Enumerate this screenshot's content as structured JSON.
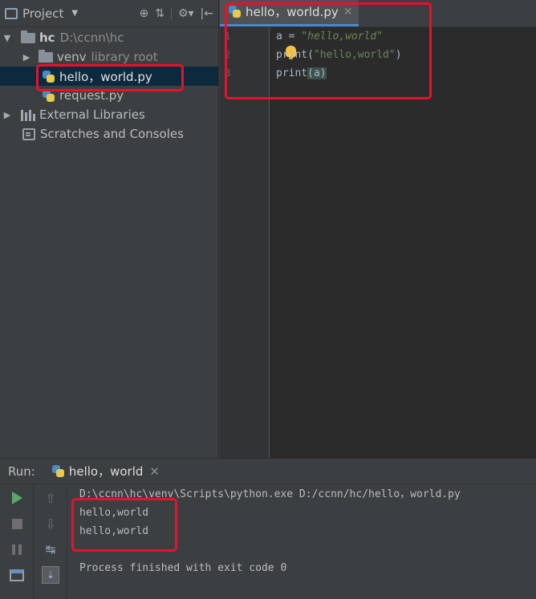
{
  "project": {
    "title": "Project",
    "tree": [
      {
        "name": "hc",
        "path": "D:\\ccnn\\hc",
        "type": "folder",
        "expanded": true
      },
      {
        "name": "venv",
        "note": "library root",
        "type": "folder",
        "expanded": false
      },
      {
        "name": "hello，world.py",
        "type": "python",
        "selected": true
      },
      {
        "name": "request.py",
        "type": "python"
      },
      {
        "name": "External Libraries",
        "type": "library"
      },
      {
        "name": "Scratches and Consoles",
        "type": "scratch"
      }
    ]
  },
  "editor": {
    "tab_label": "hello，world.py",
    "line_numbers": [
      "1",
      "2",
      "3"
    ],
    "code": {
      "l1_var": "a = ",
      "l1_str": "\"hello,world\"",
      "l2_fn": "print(",
      "l2_str": "\"hello,world\"",
      "l2_end": ")",
      "l3_fn": "print",
      "l3_arg": "(a)"
    }
  },
  "run": {
    "label": "Run:",
    "tab_label": "hello，world",
    "console": [
      "D:\\ccnn\\hc\\venv\\Scripts\\python.exe D:/ccnn/hc/hello，world.py",
      "hello,world",
      "hello,world",
      "",
      "Process finished with exit code 0"
    ]
  },
  "colors": {
    "annotation": "#e8112d",
    "selection": "#0d293e",
    "string": "#6a8759"
  }
}
